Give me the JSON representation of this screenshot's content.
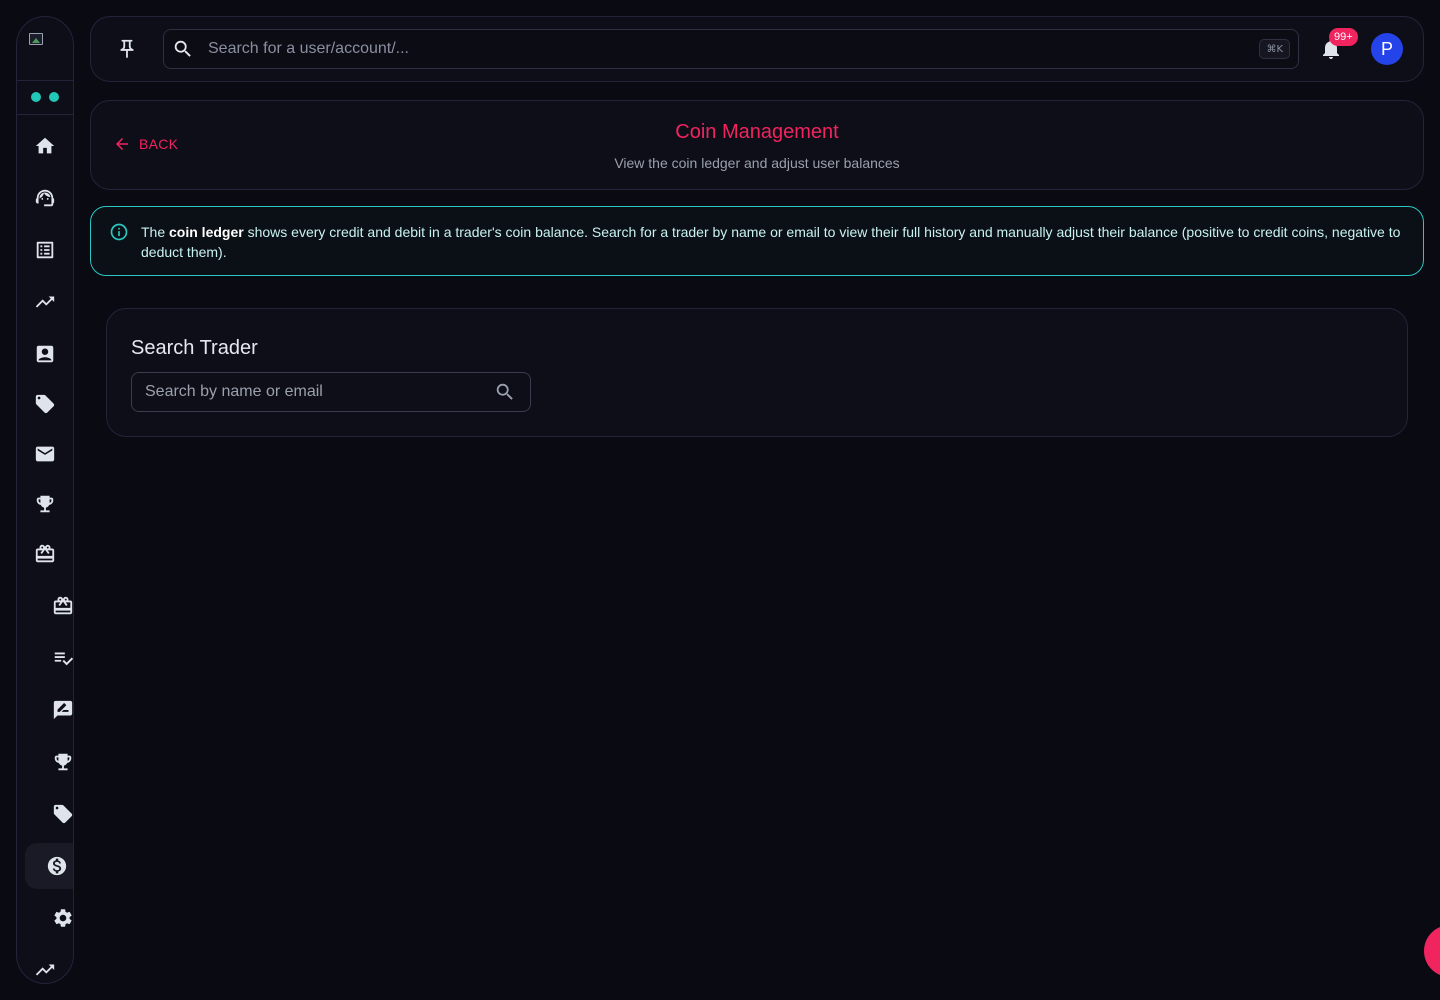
{
  "sidebar": {
    "logo_icon": "broken-image-icon",
    "status_dots": [
      "#22c7b8",
      "#22c7b8"
    ],
    "items": [
      {
        "icon": "home-icon"
      },
      {
        "icon": "support-agent-icon"
      },
      {
        "icon": "list-alt-icon"
      },
      {
        "icon": "trending-up-icon"
      },
      {
        "icon": "contact-card-icon"
      },
      {
        "icon": "tag-icon"
      },
      {
        "icon": "mail-icon"
      },
      {
        "icon": "trophy-icon"
      },
      {
        "icon": "gift-card-icon"
      },
      {
        "icon": "gift-card-icon"
      },
      {
        "icon": "playlist-check-icon"
      },
      {
        "icon": "rate-review-icon"
      },
      {
        "icon": "trophy-icon"
      },
      {
        "icon": "tag-icon"
      },
      {
        "icon": "dollar-coin-icon",
        "active": true
      },
      {
        "icon": "settings-icon"
      },
      {
        "icon": "trending-up-icon"
      }
    ]
  },
  "topbar": {
    "pin_icon": "pin-icon",
    "search_placeholder": "Search for a user/account/...",
    "shortcut": "⌘K",
    "notification_count": "99+",
    "avatar_initial": "P"
  },
  "header": {
    "back_label": "BACK",
    "title": "Coin Management",
    "subtitle": "View the coin ledger and adjust user balances"
  },
  "info_alert": {
    "prefix": "The ",
    "bold": "coin ledger",
    "suffix": " shows every credit and debit in a trader's coin balance. Search for a trader by name or email to view their full history and manually adjust their balance (positive to credit coins, negative to deduct them)."
  },
  "search_trader": {
    "title": "Search Trader",
    "placeholder": "Search by name or email"
  },
  "colors": {
    "accent": "#f0245f",
    "info": "#2cc7c2",
    "avatar": "#2443e8",
    "background": "#090a12"
  }
}
